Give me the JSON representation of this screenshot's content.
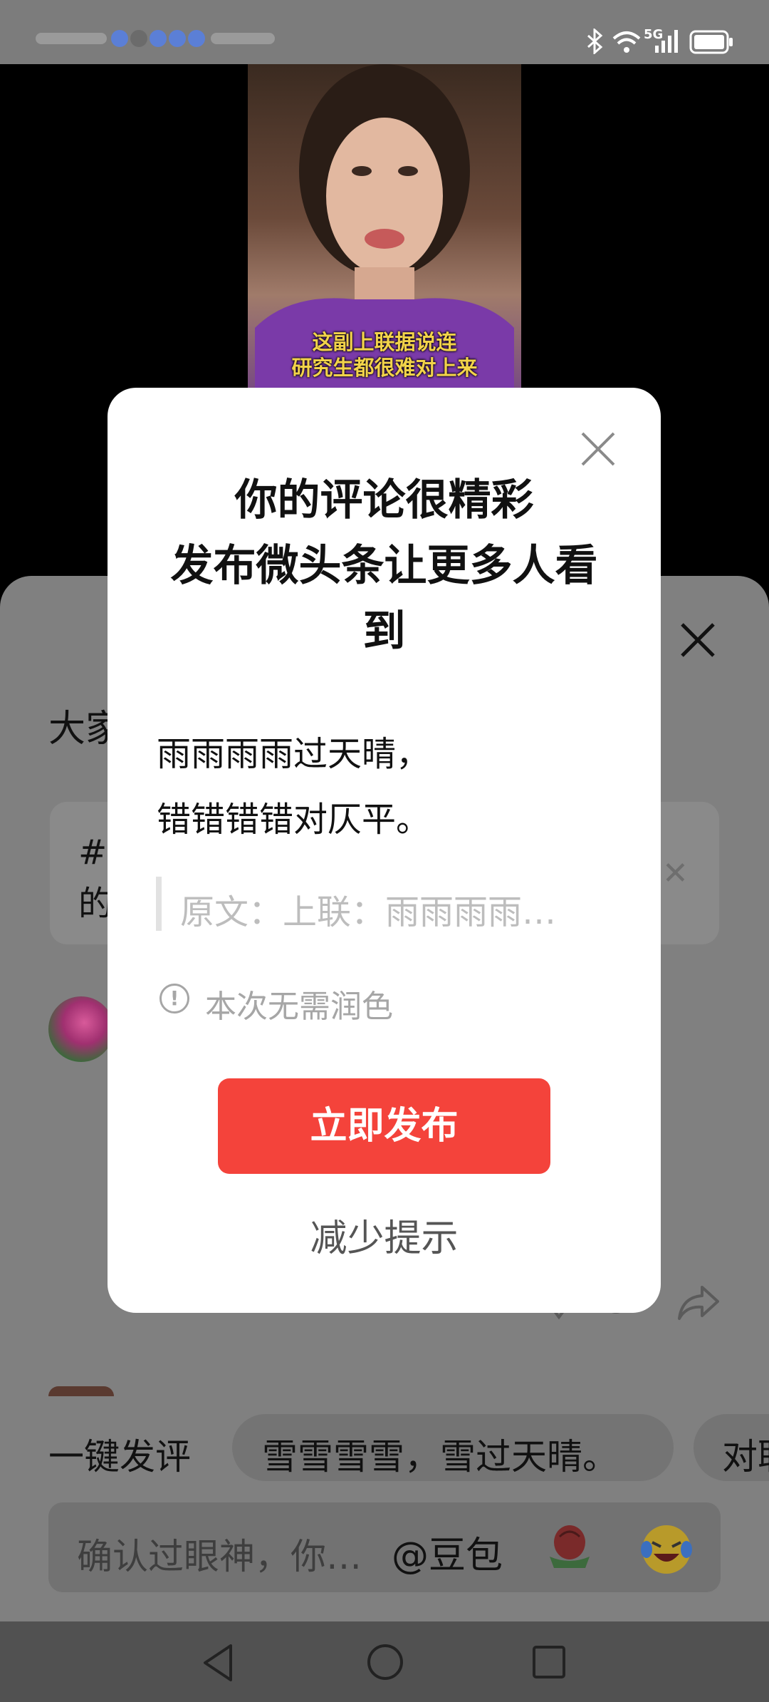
{
  "colors": {
    "accent": "#f4433b",
    "overlay": "#808080",
    "dialog_bg": "#ffffff"
  },
  "status_bar": {
    "network": "5G",
    "icons": [
      "bluetooth-icon",
      "wifi-icon",
      "signal-icon",
      "battery-icon"
    ]
  },
  "video": {
    "subtitle_line1": "这副上联据说连",
    "subtitle_line2": "研究生都很难对上来"
  },
  "sheet": {
    "title": "大家",
    "topic_text_line1": "#",
    "topic_text_line2": "的",
    "quick_label": "一键发评",
    "quick_chip": "雪雪雪雪，雪过天晴。",
    "quick_chip2": "对联",
    "input_placeholder": "确认过眼神，你…",
    "mention": "@豆包",
    "emojis": [
      "rose-emoji",
      "laughing-emoji"
    ]
  },
  "dialog": {
    "title_line1": "你的评论很精彩",
    "title_line2": "发布微头条让更多人看",
    "title_line3": "到",
    "poem_line1": "雨雨雨雨过天晴，",
    "poem_line2": "错错错错对仄平。",
    "quote": "原文：上联：雨雨雨雨…",
    "notice_icon": "!",
    "notice": "本次无需润色",
    "publish_label": "立即发布",
    "reduce_label": "减少提示"
  }
}
